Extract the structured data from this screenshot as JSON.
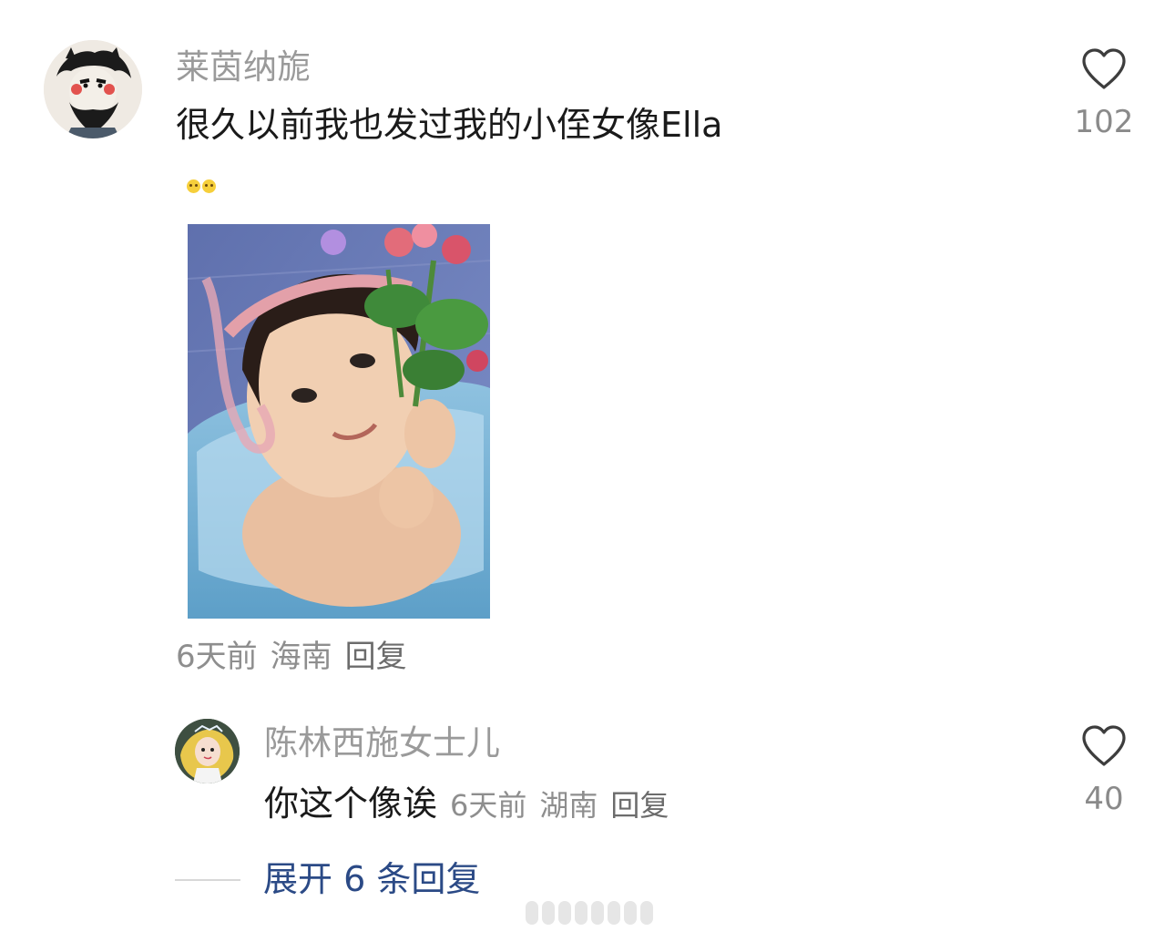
{
  "main_comment": {
    "username": "莱茵纳旎",
    "text": "很久以前我也发过我的小侄女像Ella",
    "time": "6天前",
    "location": "海南",
    "reply_label": "回复",
    "like_count": "102",
    "image_alt": "girl-with-flowers-photo"
  },
  "reply_comment": {
    "username": "陈林西施女士儿",
    "text": "你这个像诶",
    "time": "6天前",
    "location": "湖南",
    "reply_label": "回复",
    "like_count": "40"
  },
  "expand": {
    "label": "展开 6 条回复"
  },
  "colors": {
    "username": "#9a9a9a",
    "text": "#1a1a1a",
    "meta": "#8e8e8e",
    "link": "#2b4a86"
  },
  "icons": {
    "like": "heart-icon",
    "emoji": "smile-emoji-icon"
  }
}
